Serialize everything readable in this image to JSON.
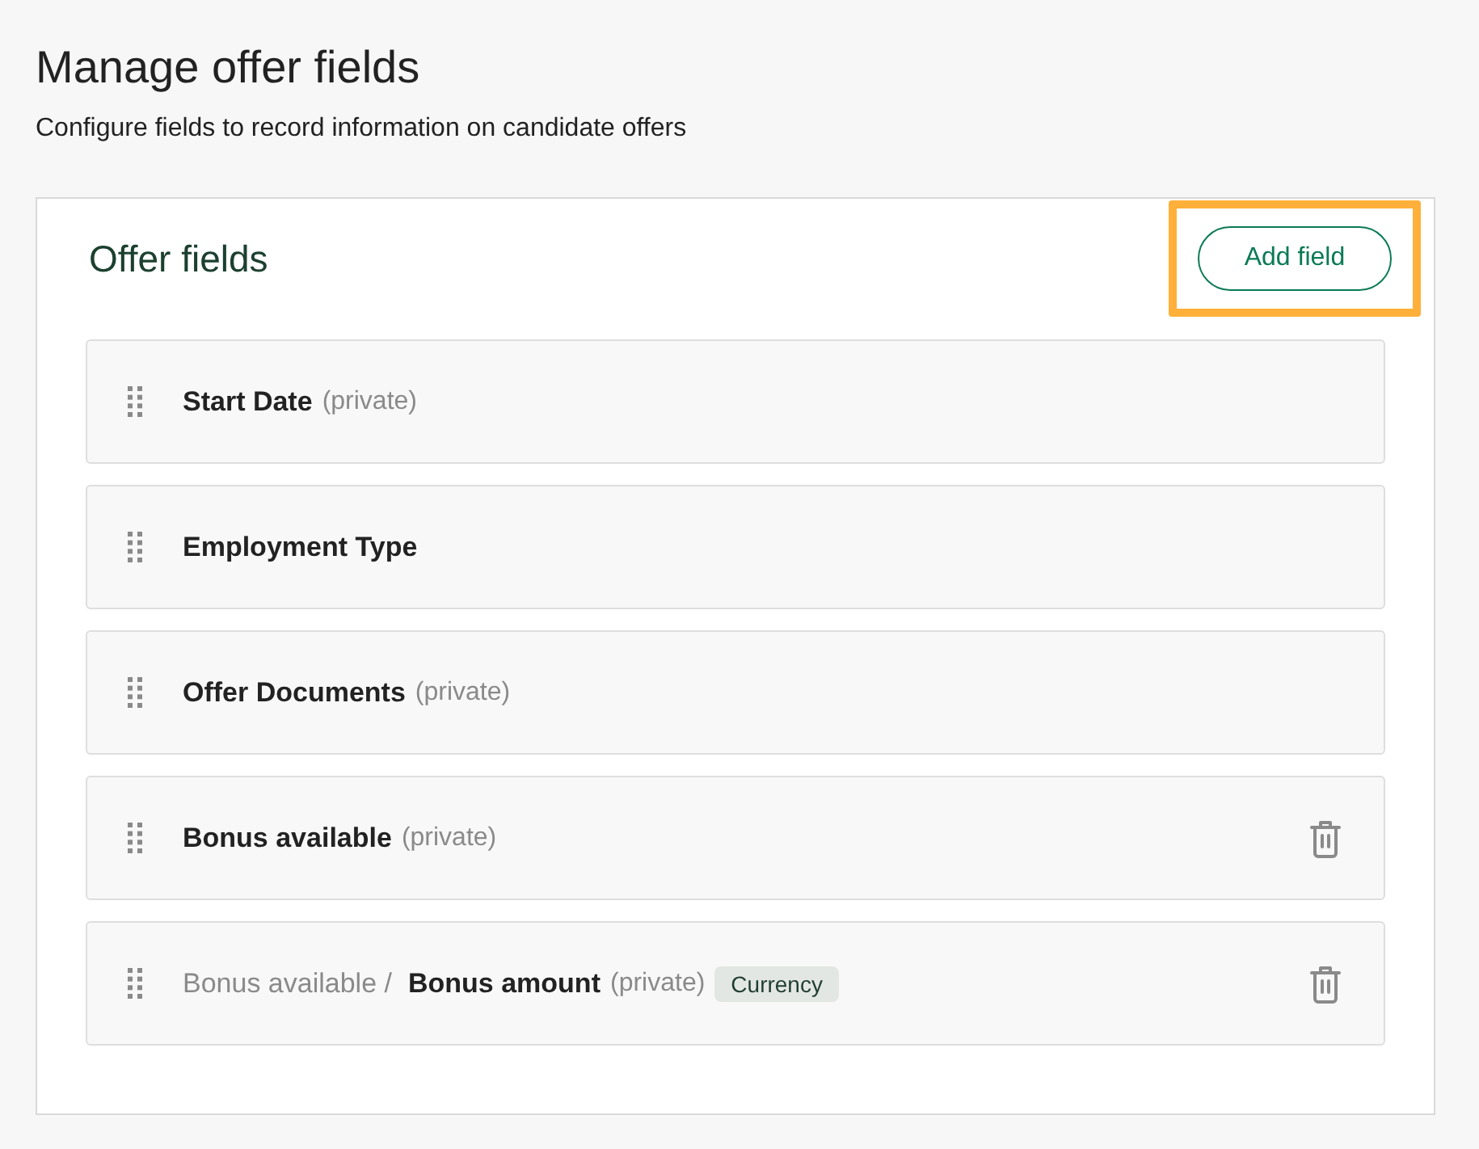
{
  "page": {
    "title": "Manage offer fields",
    "subtitle": "Configure fields to record information on candidate offers"
  },
  "card": {
    "title": "Offer fields",
    "add_button": {
      "label": "Add field",
      "highlighted": true
    },
    "fields": [
      {
        "name": "Start Date",
        "note": "(private)",
        "deletable": false
      },
      {
        "name": "Employment Type",
        "deletable": false
      },
      {
        "name": "Offer Documents",
        "note": "(private)",
        "deletable": false
      },
      {
        "name": "Bonus available",
        "note": "(private)",
        "deletable": true
      },
      {
        "parent": "Bonus available /",
        "name": "Bonus amount",
        "note": "(private)",
        "tag": "Currency",
        "deletable": true
      }
    ]
  }
}
